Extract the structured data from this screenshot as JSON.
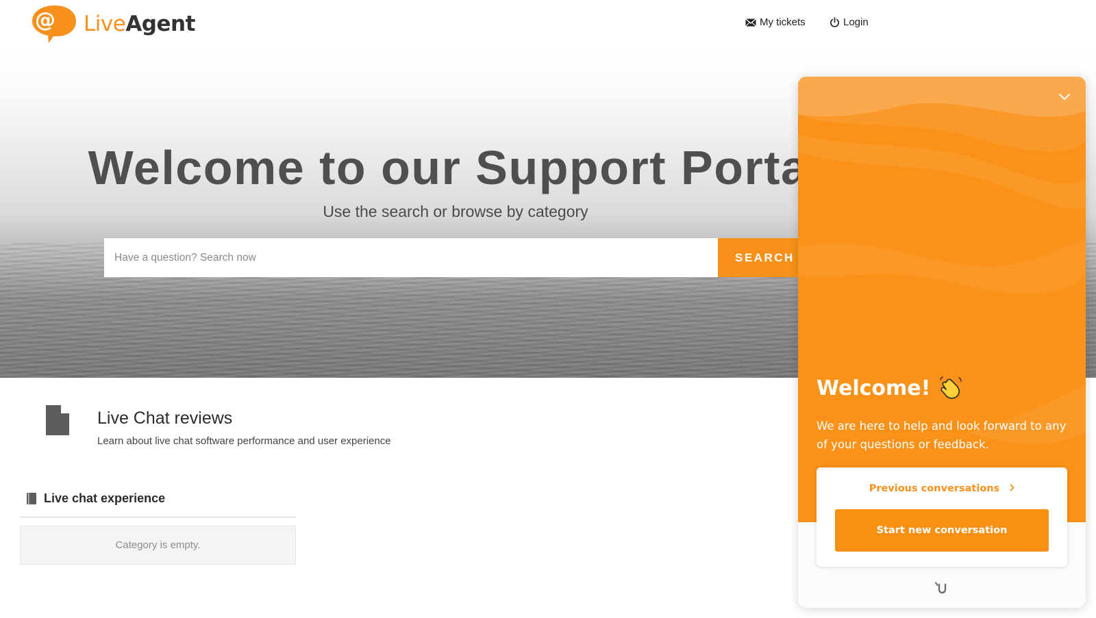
{
  "header": {
    "logo_live": "Live",
    "logo_agent": "Agent",
    "nav": {
      "my_tickets": "My tickets",
      "login": "Login"
    }
  },
  "hero": {
    "title": "Welcome to our Support Portal",
    "subtitle": "Use the search or browse by category",
    "search_placeholder": "Have a question? Search now",
    "search_button": "SEARCH"
  },
  "category": {
    "title": "Live Chat reviews",
    "description": "Learn about live chat software performance and user experience",
    "subcategory": {
      "title": "Live chat experience",
      "empty_text": "Category is empty."
    }
  },
  "chat_widget": {
    "welcome": "Welcome!",
    "message": "We are here to help and look forward to any of your questions or feedback.",
    "previous_conversations": "Previous conversations",
    "start_button": "Start new conversation",
    "accent_color": "#F7911C",
    "icons": [
      "chevron-down-icon",
      "waving-hand-icon",
      "chevron-right-icon",
      "brand-mark-icon"
    ]
  },
  "colors": {
    "brand_orange": "#F7911C",
    "text_dark": "#4F4F4F"
  }
}
